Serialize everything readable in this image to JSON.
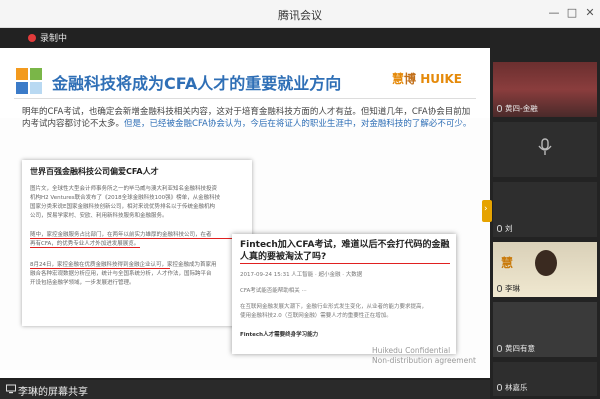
{
  "window": {
    "title": "腾讯会议",
    "controls": {
      "minimize": "—",
      "maximize": "□",
      "close": "✕"
    }
  },
  "recording": {
    "label": "录制中",
    "dot_color": "#e23b3b"
  },
  "slide": {
    "heading": "金融科技将成为CFA人才的重要就业方向",
    "brand": {
      "prefix": "慧",
      "main": "博",
      "name": "HUIKE"
    },
    "paragraph": {
      "normal": "明年的CFA考试，也确定会新增金融科技相关内容，这对于培育金融科技方面的人才有益。但知道几年，CFA协会目前加内考试内容都讨论不太多。",
      "highlight": "但是，已经被金融CFA协会认为，今后在将证人的职业生涯中，对金融科技的了解必不可少。"
    },
    "card1": {
      "title": "世界百强金融科技公司偏爱CFA人才",
      "lines": [
        "图片文，全球性大型会计师事务所之一的毕马威与澳大利亚知名金融科技投资",
        "机构H2 Ventures联合发布了《2018全球金融科技100强》榜单，从金融科技",
        "国家分类来说E国家金融科技创新公司，相对来说优势排名以于传统金融机构",
        "公司，贸易学家村、安欧、利用新科技服务和金融服务。",
        "",
        "随中，家控金融服务占比部门，在两年以前实力雄厚的金融科技公司，在者",
        "再有CFA，的优秀专业人才外加进发展展览。",
        "",
        "8月24日，家控金融在优质金融科技得到金融企业认可，家控金融成为首家用",
        "融合各种宏观数据分析应用，统计与全国系统分析，人才作法，国际跨平台",
        "开设包括金融学领域，一步发展进行管理。"
      ]
    },
    "card2": {
      "title": "Fintech加入CFA考试，难道以后不会打代码的金融人真的要被淘汰了吗?",
      "lines": [
        "2017-09-24 15:31  人工智能  · 超小金融 · 大数据",
        "",
        "CFA考试能否能帮助相关 ···",
        "",
        "在互联网金融发展大潮下，金融行业形式发生变化，从业者的能力要求提高，",
        "使用金融科技2.0（互联网金融）需要人才的重要性正在增加。",
        "",
        "Fintech人才需要终身学习能力"
      ]
    },
    "watermark": {
      "line1": "Huikedu Confidential",
      "line2": "Non-distribution agreement"
    }
  },
  "share": {
    "label": "李琳的屏幕共享"
  },
  "participants": [
    {
      "name": "黄四-金融"
    },
    {
      "name": ""
    },
    {
      "name": "刘"
    },
    {
      "name": "李琳"
    },
    {
      "name": "黄四有意"
    },
    {
      "name": "林嘉乐"
    }
  ]
}
